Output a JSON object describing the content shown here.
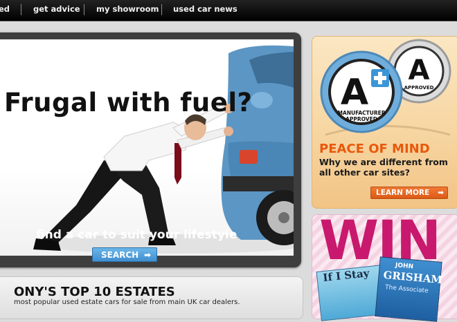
{
  "nav": {
    "items": [
      "ed",
      "get advice",
      "my showroom",
      "used car news"
    ]
  },
  "hero": {
    "title": "Frugal with fuel?",
    "tagline": "find a car to suit your lifestyle",
    "search_label": "SEARCH",
    "arrow": "➡"
  },
  "top10": {
    "title": "ONY'S TOP 10 ESTATES",
    "subtitle": "most popular used estate cars for sale from main UK car dealers."
  },
  "promo": {
    "badge_big_line1": "MANUFACTURER",
    "badge_big_line2": "APPROVED",
    "badge_small": "APPROVED",
    "heading": "PEACE OF MIND",
    "text": "Why we are different from all other car sites?",
    "button_label": "LEARN MORE",
    "arrow": "➡"
  },
  "win": {
    "title": "WIN",
    "book1_title": "If I Stay",
    "book2_author": "JOHN",
    "book2_name": "GRISHAM",
    "book2_title": "The Associate"
  },
  "colors": {
    "accent_orange": "#e8590c",
    "accent_blue": "#3f8fd0",
    "win_magenta": "#c8196e"
  }
}
